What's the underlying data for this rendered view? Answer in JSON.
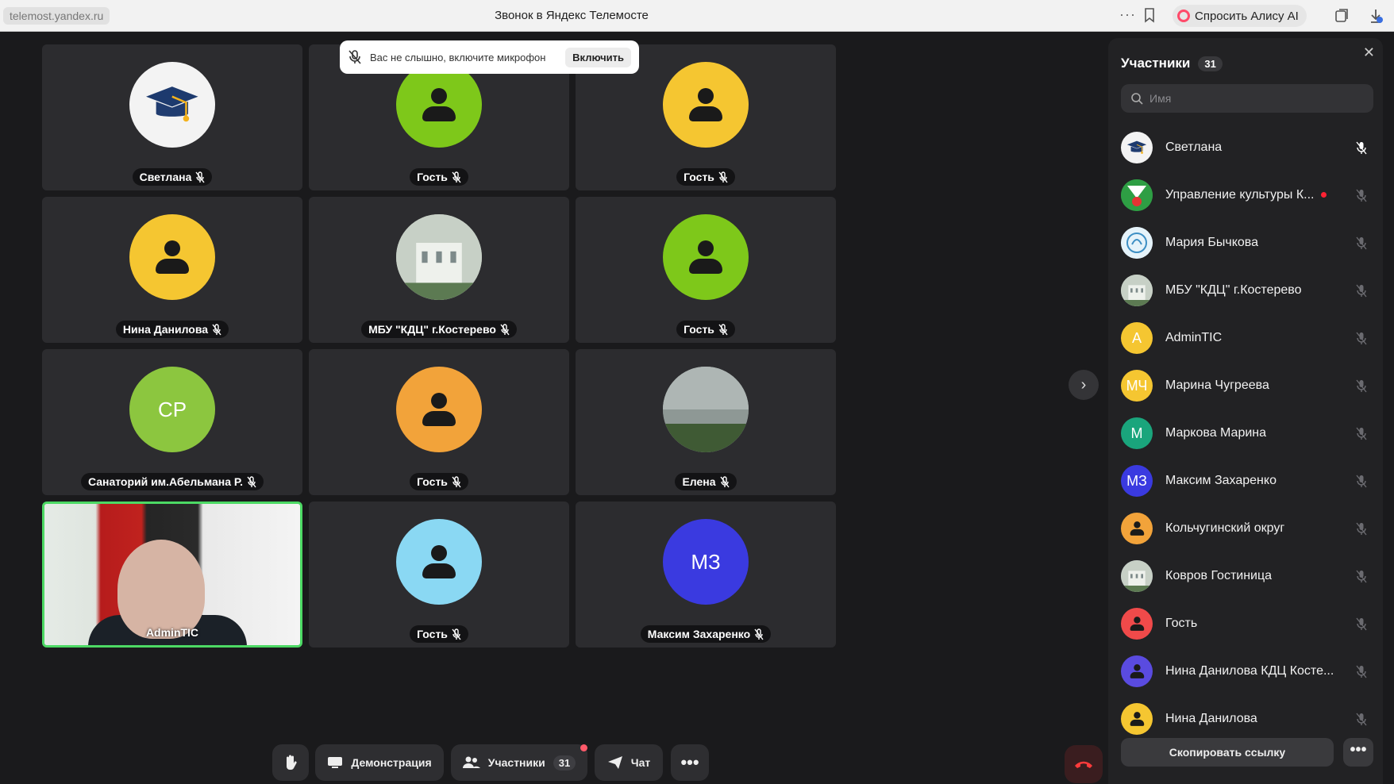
{
  "browser": {
    "url": "telemost.yandex.ru",
    "title": "Звонок в Яндекс Телемосте",
    "alice_label": "Спросить Алису AI"
  },
  "notification": {
    "text": "Вас не слышно, включите микрофон",
    "button": "Включить"
  },
  "tiles": [
    {
      "name": "Светлана",
      "avatar": "graduation-cap",
      "color": "#f3f3f3",
      "initials": ""
    },
    {
      "name": "Гость",
      "avatar": "person",
      "color": "#7ec81a",
      "initials": ""
    },
    {
      "name": "Гость",
      "avatar": "person",
      "color": "#f5c631",
      "initials": ""
    },
    {
      "name": "Нина Данилова",
      "avatar": "person",
      "color": "#f5c631",
      "initials": ""
    },
    {
      "name": "МБУ \"КДЦ\" г.Костерево",
      "avatar": "building-photo",
      "color": "#b9c2b5",
      "initials": ""
    },
    {
      "name": "Гость",
      "avatar": "person",
      "color": "#7ec81a",
      "initials": ""
    },
    {
      "name": "Санаторий им.Абельмана Р.",
      "avatar": "initials",
      "color": "#8cc63f",
      "initials": "СР"
    },
    {
      "name": "Гость",
      "avatar": "person",
      "color": "#f2a33a",
      "initials": ""
    },
    {
      "name": "Елена",
      "avatar": "landscape-photo",
      "color": "#7f8a83",
      "initials": ""
    },
    {
      "name": "AdminTIC",
      "avatar": "video",
      "color": "#c9d3cc",
      "initials": ""
    },
    {
      "name": "Гость",
      "avatar": "person",
      "color": "#8ad8f3",
      "initials": ""
    },
    {
      "name": "Максим Захаренко",
      "avatar": "initials",
      "color": "#3a3ae0",
      "initials": "МЗ"
    }
  ],
  "toolbar": {
    "demo": "Демонстрация",
    "participants": "Участники",
    "participants_count": "31",
    "chat": "Чат"
  },
  "panel": {
    "title": "Участники",
    "count": "31",
    "search_placeholder": "Имя",
    "copy_link": "Скопировать ссылку",
    "participants": [
      {
        "name": "Светлана",
        "avatar": "graduation-cap",
        "color": "#f3f3f3",
        "initials": ""
      },
      {
        "name": "Управление культуры К...",
        "avatar": "emblem",
        "color": "#2e9e44",
        "initials": ""
      },
      {
        "name": "Мария Бычкова",
        "avatar": "logo",
        "color": "#dff0f7",
        "initials": ""
      },
      {
        "name": "МБУ \"КДЦ\" г.Костерево",
        "avatar": "building-photo",
        "color": "#b9c2b5",
        "initials": ""
      },
      {
        "name": "AdminTIC",
        "avatar": "initials",
        "color": "#f5c631",
        "initials": "A"
      },
      {
        "name": "Марина Чугреева",
        "avatar": "initials",
        "color": "#f5c631",
        "initials": "МЧ"
      },
      {
        "name": "Маркова Марина",
        "avatar": "initials",
        "color": "#1aa57c",
        "initials": "М"
      },
      {
        "name": "Максим Захаренко",
        "avatar": "initials",
        "color": "#3a3ae0",
        "initials": "МЗ"
      },
      {
        "name": "Кольчугинский округ",
        "avatar": "person",
        "color": "#f2a33a",
        "initials": ""
      },
      {
        "name": "Ковров Гостиница",
        "avatar": "building-photo",
        "color": "#8d96a3",
        "initials": ""
      },
      {
        "name": "Гость",
        "avatar": "person",
        "color": "#f04a4a",
        "initials": ""
      },
      {
        "name": "Нина Данилова КДЦ Косте...",
        "avatar": "person",
        "color": "#5a4be0",
        "initials": ""
      },
      {
        "name": "Нина Данилова",
        "avatar": "person",
        "color": "#f5c631",
        "initials": ""
      }
    ]
  }
}
